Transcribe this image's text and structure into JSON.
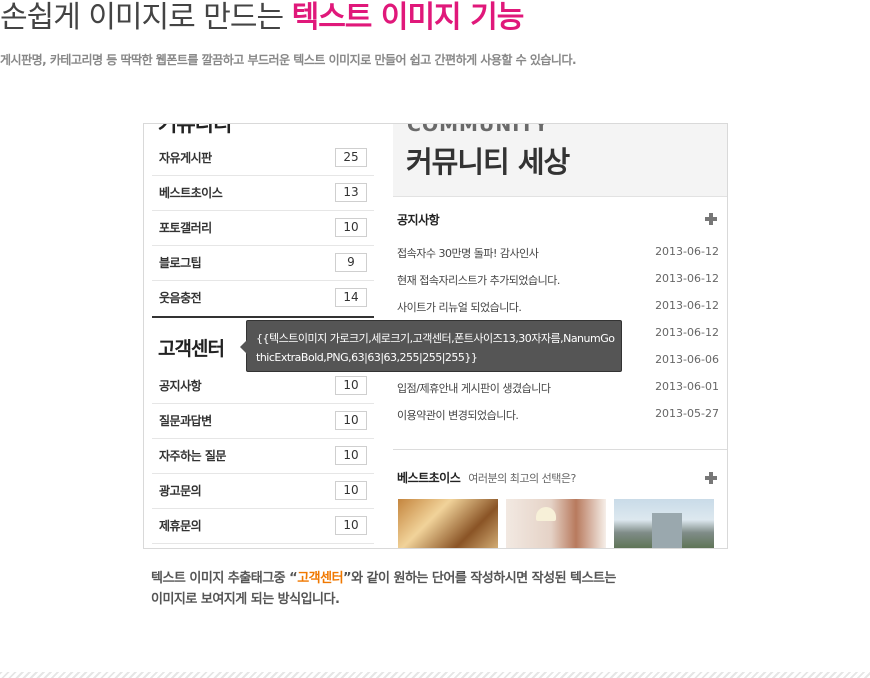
{
  "header": {
    "title_plain": "손쉽게 이미지로 만드는 ",
    "title_accent": "텍스트 이미지 기능",
    "subtitle": "게시판명, 카테고리명 등 딱딱한 웹폰트를 깔끔하고 부드러운 텍스트 이미지로 만들어 쉽고 간편하게 사용할 수 있습니다."
  },
  "colors": {
    "accent": "#e0187a",
    "highlight": "#f07800",
    "tooltip_bg": "#555555"
  },
  "sidebar": {
    "cut_title": "커뮤니티",
    "community_items": [
      {
        "label": "자유게시판",
        "count": "25"
      },
      {
        "label": "베스트초이스",
        "count": "13"
      },
      {
        "label": "포토갤러리",
        "count": "10"
      },
      {
        "label": "블로그팁",
        "count": "9"
      },
      {
        "label": "웃음충전",
        "count": "14"
      }
    ],
    "support_title": "고객센터",
    "support_items": [
      {
        "label": "공지사항",
        "count": "10"
      },
      {
        "label": "질문과답변",
        "count": "10"
      },
      {
        "label": "자주하는 질문",
        "count": "10"
      },
      {
        "label": "광고문의",
        "count": "10"
      },
      {
        "label": "제휴문의",
        "count": "10"
      }
    ]
  },
  "hero": {
    "en": "COMMUNITY",
    "ko": "커뮤니티 세상"
  },
  "notices": {
    "title": "공지사항",
    "more_icon": "plus-icon",
    "items": [
      {
        "title": "접속자수 30만명 돌파! 감사인사",
        "date": "2013-06-12"
      },
      {
        "title": "현재 접속자리스트가 추가되었습니다.",
        "date": "2013-06-12"
      },
      {
        "title": "사이트가 리뉴얼 되었습니다.",
        "date": "2013-06-12"
      },
      {
        "title": "",
        "date": "2013-06-12"
      },
      {
        "title": "",
        "date": "2013-06-06"
      },
      {
        "title": "입점/제휴안내 게시판이 생겼습니다",
        "date": "2013-06-01"
      },
      {
        "title": "이용약관이 변경되었습니다.",
        "date": "2013-05-27"
      }
    ]
  },
  "best": {
    "title": "베스트초이스",
    "subtitle": "여러분의 최고의 선택은?",
    "more_icon": "plus-icon"
  },
  "tooltip": {
    "text": "{{텍스트이미지 가로크기,세로크기,고객센터,폰트사이즈13,30자자름,NanumGothicExtraBold,PNG,63|63|63,255|255|255}}"
  },
  "caption": {
    "part1": "텍스트 이미지 추출태그중 “",
    "highlight": "고객센터",
    "part2": "”와 같이 원하는 단어를 작성하시면 작성된 텍스트는",
    "line2": "이미지로 보여지게 되는 방식입니다."
  }
}
